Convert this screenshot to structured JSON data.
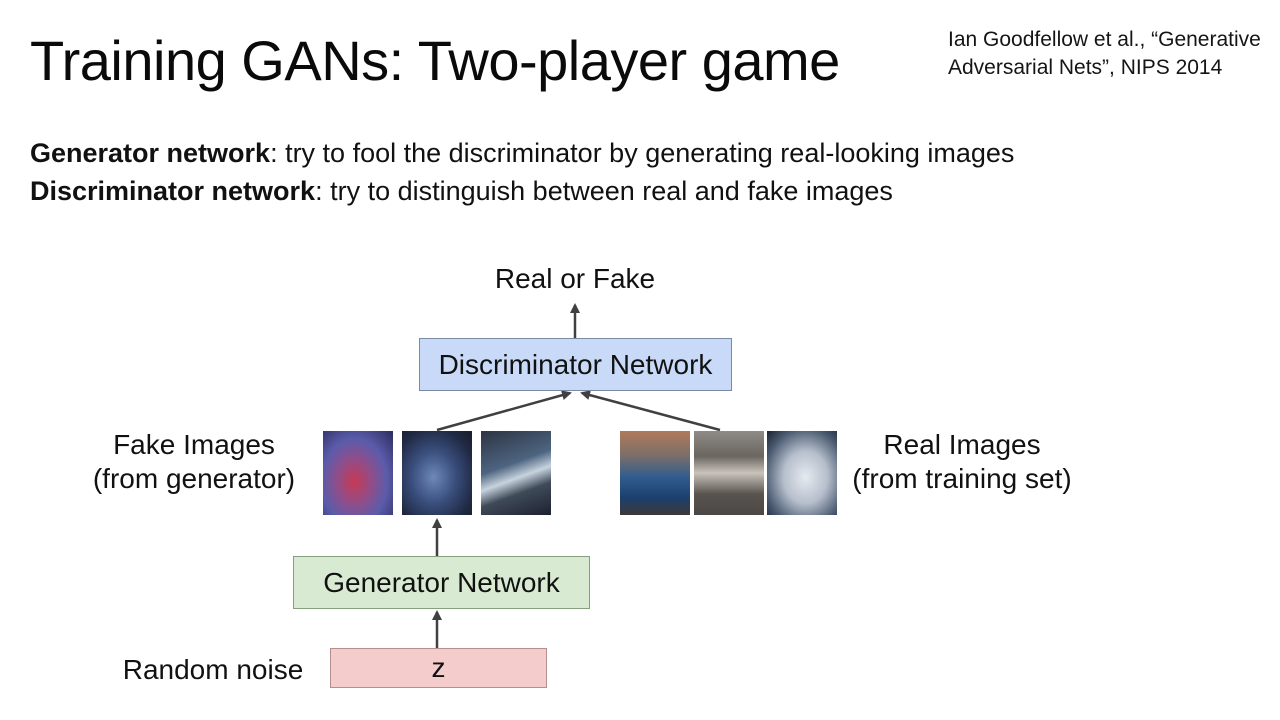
{
  "slide": {
    "title": "Training GANs: Two-player game",
    "citation_line1": "Ian Goodfellow et al., “Generative",
    "citation_line2": "Adversarial Nets”, NIPS 2014",
    "desc1_bold": "Generator network",
    "desc1_text": ": try to fool the discriminator by generating real-looking images",
    "desc2_bold": "Discriminator network",
    "desc2_text": ": try to distinguish between real and fake images"
  },
  "diagram": {
    "output_label": "Real or Fake",
    "discriminator_label": "Discriminator Network",
    "fake_label_line1": "Fake Images",
    "fake_label_line2": "(from generator)",
    "real_label_line1": "Real Images",
    "real_label_line2": "(from training set)",
    "generator_label": "Generator Network",
    "noise_label": "Random noise",
    "z_label": "z",
    "colors": {
      "discriminator_fill": "#c9daf8",
      "generator_fill": "#d9ead3",
      "noise_fill": "#f4cccc",
      "arrow": "#404040"
    }
  }
}
